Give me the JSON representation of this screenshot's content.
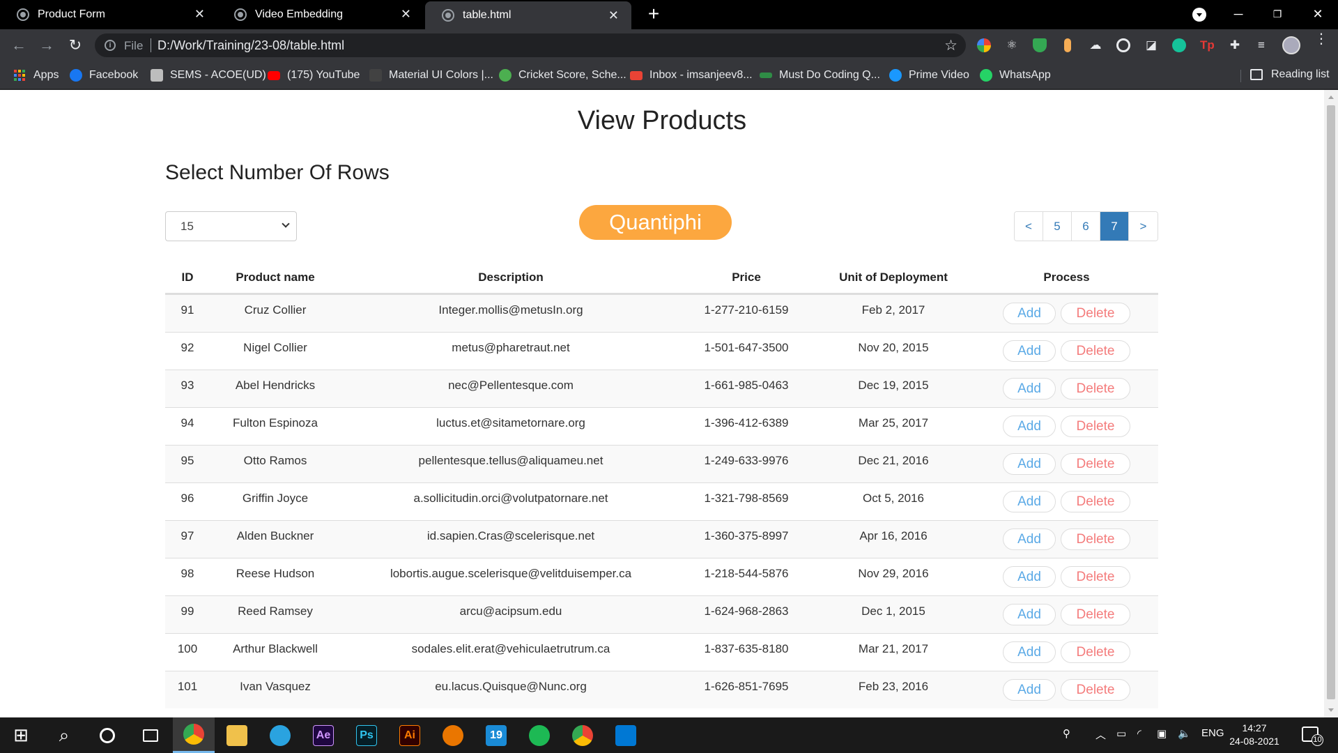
{
  "browser": {
    "tabs": [
      {
        "title": "Product Form",
        "active": false
      },
      {
        "title": "Video Embedding",
        "active": false
      },
      {
        "title": "table.html",
        "active": true
      }
    ],
    "address": {
      "scheme": "File",
      "url": "D:/Work/Training/23-08/table.html"
    },
    "bookmarks": [
      {
        "label": "Apps",
        "icon": "apps-grid-icon"
      },
      {
        "label": "Facebook",
        "icon": "facebook-icon",
        "color": "#1877f2"
      },
      {
        "label": "SEMS - ACOE(UD)",
        "icon": "sems-icon",
        "color": "#bdbdbd"
      },
      {
        "label": "(175) YouTube",
        "icon": "youtube-icon",
        "color": "#ff0000"
      },
      {
        "label": "Material UI Colors |...",
        "icon": "material-ui-icon",
        "color": "#424242"
      },
      {
        "label": "Cricket Score, Sche...",
        "icon": "cricbuzz-icon",
        "color": "#4caf50"
      },
      {
        "label": "Inbox - imsanjeev8...",
        "icon": "gmail-icon",
        "color": "#ea4335"
      },
      {
        "label": "Must Do Coding Q...",
        "icon": "geeksforgeeks-icon",
        "color": "#2f8d46"
      },
      {
        "label": "Prime Video",
        "icon": "prime-video-icon",
        "color": "#1a98ff"
      },
      {
        "label": "WhatsApp",
        "icon": "whatsapp-icon",
        "color": "#25d366"
      }
    ],
    "reading_list": "Reading list"
  },
  "page": {
    "title": "View Products",
    "rows_label": "Select Number Of Rows",
    "rows_selected": "15",
    "brand": "Quantiphi",
    "brand_color": "#fca73f",
    "pagination": {
      "prev": "<",
      "pages": [
        "5",
        "6",
        "7"
      ],
      "current": "7",
      "next": ">"
    },
    "table": {
      "headers": [
        "ID",
        "Product name",
        "Description",
        "Price",
        "Unit of Deployment",
        "Process"
      ],
      "add_label": "Add",
      "delete_label": "Delete",
      "rows": [
        {
          "id": "91",
          "name": "Cruz Collier",
          "desc": "Integer.mollis@metusIn.org",
          "price": "1-277-210-6159",
          "unit": "Feb 2, 2017"
        },
        {
          "id": "92",
          "name": "Nigel Collier",
          "desc": "metus@pharetraut.net",
          "price": "1-501-647-3500",
          "unit": "Nov 20, 2015"
        },
        {
          "id": "93",
          "name": "Abel Hendricks",
          "desc": "nec@Pellentesque.com",
          "price": "1-661-985-0463",
          "unit": "Dec 19, 2015"
        },
        {
          "id": "94",
          "name": "Fulton Espinoza",
          "desc": "luctus.et@sitametornare.org",
          "price": "1-396-412-6389",
          "unit": "Mar 25, 2017"
        },
        {
          "id": "95",
          "name": "Otto Ramos",
          "desc": "pellentesque.tellus@aliquameu.net",
          "price": "1-249-633-9976",
          "unit": "Dec 21, 2016"
        },
        {
          "id": "96",
          "name": "Griffin Joyce",
          "desc": "a.sollicitudin.orci@volutpatornare.net",
          "price": "1-321-798-8569",
          "unit": "Oct 5, 2016"
        },
        {
          "id": "97",
          "name": "Alden Buckner",
          "desc": "id.sapien.Cras@scelerisque.net",
          "price": "1-360-375-8997",
          "unit": "Apr 16, 2016"
        },
        {
          "id": "98",
          "name": "Reese Hudson",
          "desc": "lobortis.augue.scelerisque@velitduisemper.ca",
          "price": "1-218-544-5876",
          "unit": "Nov 29, 2016"
        },
        {
          "id": "99",
          "name": "Reed Ramsey",
          "desc": "arcu@acipsum.edu",
          "price": "1-624-968-2863",
          "unit": "Dec 1, 2015"
        },
        {
          "id": "100",
          "name": "Arthur Blackwell",
          "desc": "sodales.elit.erat@vehiculaetrutrum.ca",
          "price": "1-837-635-8180",
          "unit": "Mar 21, 2017"
        },
        {
          "id": "101",
          "name": "Ivan Vasquez",
          "desc": "eu.lacus.Quisque@Nunc.org",
          "price": "1-626-851-7695",
          "unit": "Feb 23, 2016"
        }
      ]
    }
  },
  "taskbar": {
    "apps": [
      {
        "name": "start-icon",
        "label": ""
      },
      {
        "name": "search-icon",
        "label": ""
      },
      {
        "name": "cortana-icon",
        "label": ""
      },
      {
        "name": "task-view-icon",
        "label": ""
      },
      {
        "name": "chrome-icon",
        "label": "",
        "active": true
      },
      {
        "name": "file-explorer-icon",
        "label": ""
      },
      {
        "name": "telegram-icon",
        "label": ""
      },
      {
        "name": "after-effects-icon",
        "label": "Ae"
      },
      {
        "name": "photoshop-icon",
        "label": "Ps"
      },
      {
        "name": "illustrator-icon",
        "label": "Ai"
      },
      {
        "name": "blender-icon",
        "label": ""
      },
      {
        "name": "app-19-icon",
        "label": "19"
      },
      {
        "name": "spotify-icon",
        "label": ""
      },
      {
        "name": "chrome-profile-icon",
        "label": ""
      },
      {
        "name": "vscode-icon",
        "label": ""
      }
    ],
    "language": "ENG",
    "time": "14:27",
    "date": "24-08-2021",
    "notifications": "10"
  }
}
